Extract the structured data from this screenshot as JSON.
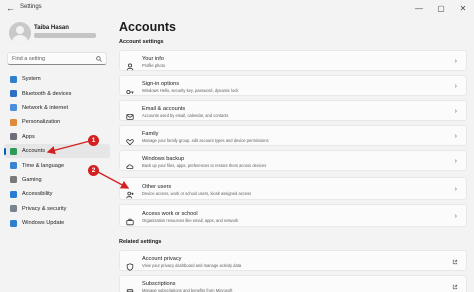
{
  "window": {
    "app_title": "Settings",
    "controls": [
      "—",
      "▢",
      "✕"
    ]
  },
  "profile": {
    "name": "Taiba Hasan"
  },
  "search": {
    "placeholder": "Find a setting"
  },
  "nav": {
    "items": [
      {
        "label": "System",
        "icon": "system-icon",
        "color": "#2f7fd1"
      },
      {
        "label": "Bluetooth & devices",
        "icon": "bluetooth-icon",
        "color": "#2c6fc4"
      },
      {
        "label": "Network & internet",
        "icon": "network-icon",
        "color": "#4a8fdb"
      },
      {
        "label": "Personalization",
        "icon": "brush-icon",
        "color": "#e08a3c"
      },
      {
        "label": "Apps",
        "icon": "apps-icon",
        "color": "#6a6f7a"
      },
      {
        "label": "Accounts",
        "icon": "accounts-icon",
        "color": "#2b9a5a",
        "active": true
      },
      {
        "label": "Time & language",
        "icon": "globe-icon",
        "color": "#3a84d0"
      },
      {
        "label": "Gaming",
        "icon": "gaming-icon",
        "color": "#7a7a7a"
      },
      {
        "label": "Accessibility",
        "icon": "accessibility-icon",
        "color": "#2a7bd6"
      },
      {
        "label": "Privacy & security",
        "icon": "shield-icon",
        "color": "#7a8391"
      },
      {
        "label": "Windows Update",
        "icon": "update-icon",
        "color": "#2f7fd1"
      }
    ]
  },
  "main": {
    "title": "Accounts",
    "account_settings_label": "Account settings",
    "related_settings_label": "Related settings",
    "cards": [
      {
        "title": "Your info",
        "desc": "Profile photo",
        "icon": "person-icon"
      },
      {
        "title": "Sign-in options",
        "desc": "Windows Hello, security key, password, dynamic lock",
        "icon": "key-icon"
      },
      {
        "title": "Email & accounts",
        "desc": "Accounts used by email, calendar, and contacts",
        "icon": "mail-icon"
      },
      {
        "title": "Family",
        "desc": "Manage your family group, edit account types and device permissions",
        "icon": "heart-icon"
      },
      {
        "title": "Windows backup",
        "desc": "Back up your files, apps, preferences to restore them across devices",
        "icon": "backup-icon"
      },
      {
        "title": "Other users",
        "desc": "Device access, work or school users, kiosk assigned access",
        "icon": "add-user-icon"
      },
      {
        "title": "Access work or school",
        "desc": "Organization resources like email, apps, and network",
        "icon": "briefcase-icon"
      }
    ],
    "related": [
      {
        "title": "Account privacy",
        "desc": "View your privacy dashboard and manage activity data",
        "icon": "shield-icon"
      },
      {
        "title": "Subscriptions",
        "desc": "Manage subscriptions and benefits from Microsoft",
        "icon": "subscriptions-icon"
      }
    ]
  },
  "annotations": [
    {
      "label": "1"
    },
    {
      "label": "2"
    }
  ],
  "colors": {
    "accent": "#005fb8",
    "annotation": "#d32020"
  }
}
